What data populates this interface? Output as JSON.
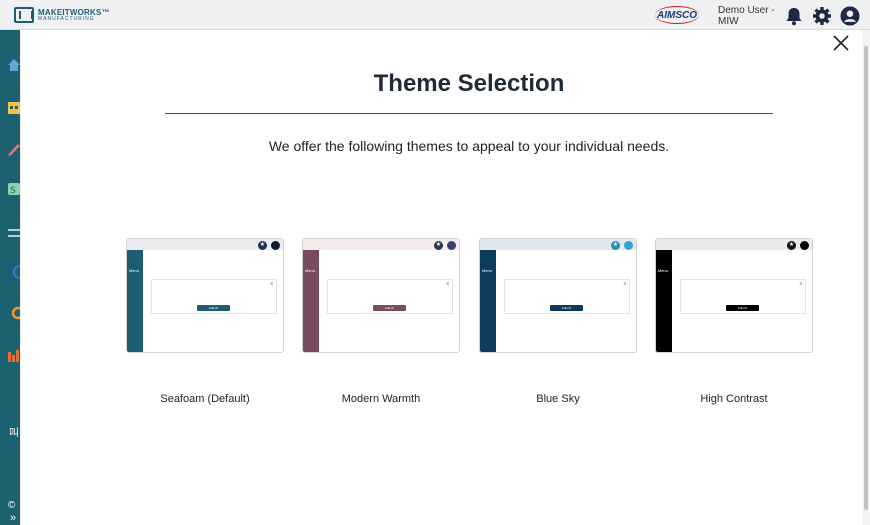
{
  "header": {
    "logo_name": "MAKEITWORKS™",
    "logo_sub": "MANUFACTURING",
    "partner": "AIMSCO",
    "user_line1": "Demo User -",
    "user_line2": "MIW",
    "icons": [
      "bell-icon",
      "gear-icon",
      "user-circle-icon"
    ]
  },
  "sidebar": {
    "icons": [
      "home-icon",
      "calendar-icon",
      "wrench-icon",
      "stack-icon",
      "transfer-icon",
      "clock-icon",
      "refresh-icon",
      "bar-chart-icon"
    ],
    "footer_text": "©",
    "footer_toggle": "»",
    "footer_mid": "叫"
  },
  "modal": {
    "title": "Theme Selection",
    "subtitle": "We offer the following themes to appeal to your individual needs.",
    "close_icon": "close-icon",
    "themes": [
      {
        "label": "Seafoam (Default)",
        "menu": "Menu",
        "button": "Submit",
        "sidebar_color": "#1b5e73",
        "header_color": "#e9ecee",
        "accent_1": "#1e3052",
        "accent_2": "#111b33",
        "button_color": "#1b5e73"
      },
      {
        "label": "Modern Warmth",
        "menu": "Menu",
        "button": "Submit",
        "sidebar_color": "#7a4a5e",
        "header_color": "#f4eceb",
        "accent_1": "#2d3556",
        "accent_2": "#3b3f78",
        "button_color": "#7a4a5e"
      },
      {
        "label": "Blue Sky",
        "menu": "Menu",
        "button": "Submit",
        "sidebar_color": "#0d3b5c",
        "header_color": "#dfe9ee",
        "accent_1": "#2a8db0",
        "accent_2": "#2da6d6",
        "button_color": "#0d3b5c"
      },
      {
        "label": "High Contrast",
        "menu": "Menu",
        "button": "Submit",
        "sidebar_color": "#000000",
        "header_color": "#e9e9e9",
        "accent_1": "#111111",
        "accent_2": "#000000",
        "button_color": "#000000"
      }
    ]
  },
  "colors": {
    "brand": "#1c6170",
    "title": "#1f2a36",
    "divider": "#2d6065"
  }
}
